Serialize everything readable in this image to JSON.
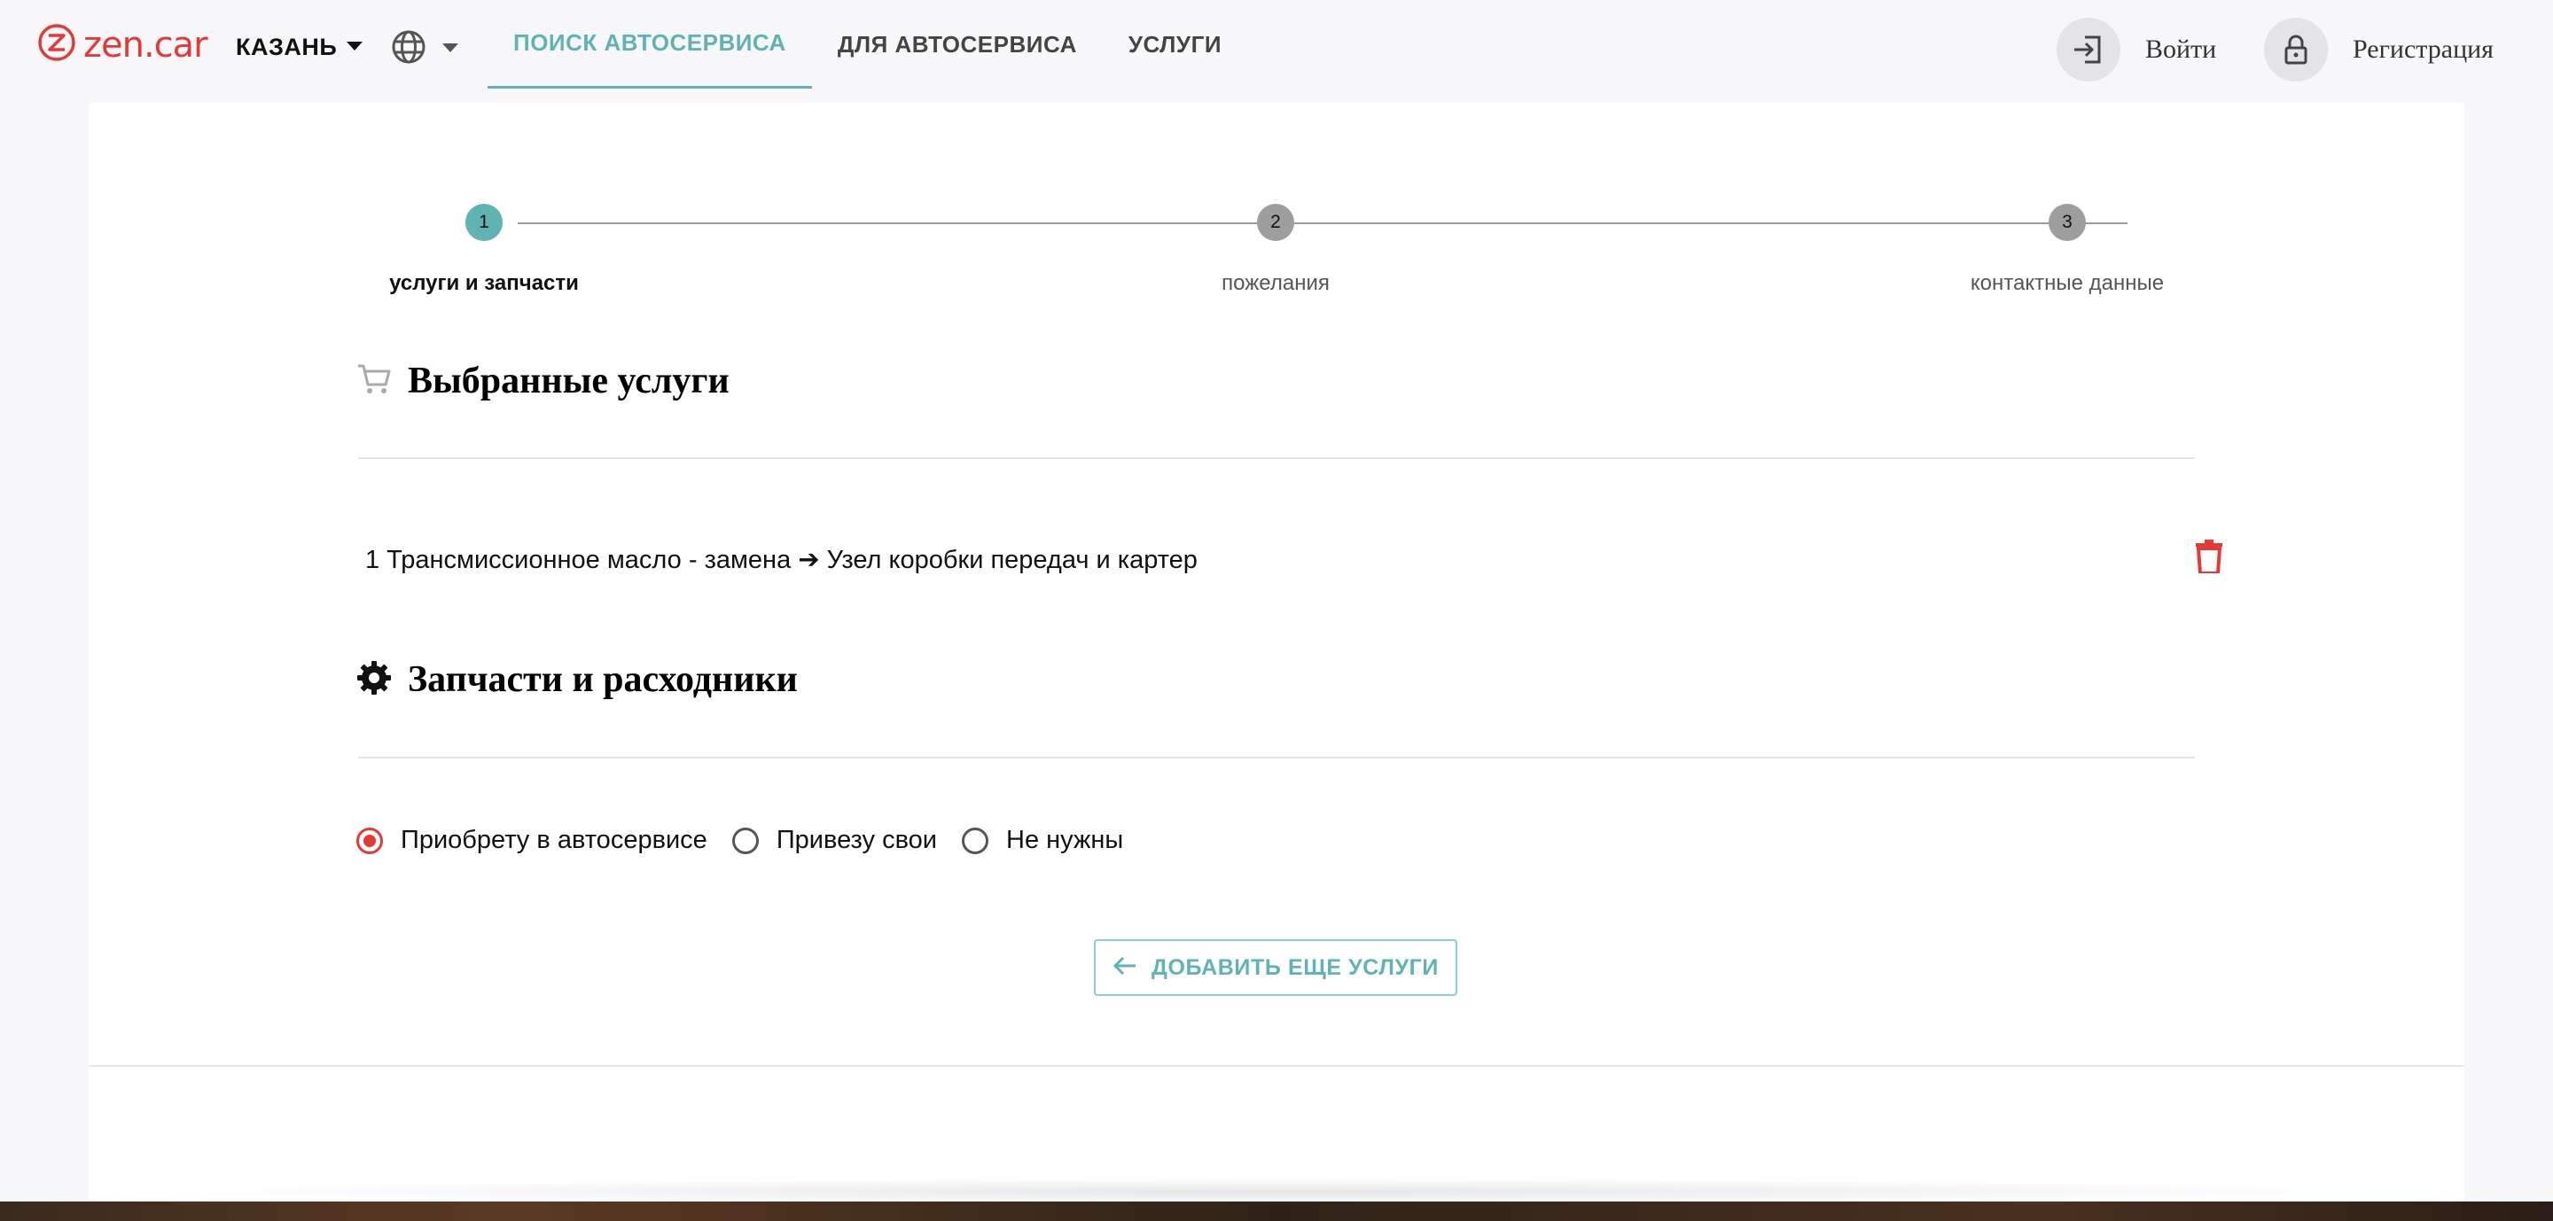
{
  "header": {
    "logo_text": "zen.car",
    "city": "КАЗАНЬ",
    "nav": [
      {
        "label": "ПОИСК АВТОСЕРВИСА",
        "active": true
      },
      {
        "label": "ДЛЯ АВТОСЕРВИСА",
        "active": false
      },
      {
        "label": "УСЛУГИ",
        "active": false
      }
    ],
    "login_label": "Войти",
    "register_label": "Регистрация"
  },
  "stepper": {
    "current": 1,
    "steps": [
      {
        "number": "1",
        "label": "услуги и запчасти"
      },
      {
        "number": "2",
        "label": "пожелания"
      },
      {
        "number": "3",
        "label": "контактные данные"
      }
    ]
  },
  "selected_services": {
    "title": "Выбранные услуги",
    "items": [
      {
        "text": "1 Трансмиссионное масло - замена ➔ Узел коробки передач и картер"
      }
    ]
  },
  "parts": {
    "title": "Запчасти и расходники",
    "options": [
      {
        "label": "Приобрету в автосервисе",
        "selected": true
      },
      {
        "label": "Привезу свои",
        "selected": false
      },
      {
        "label": "Не нужны",
        "selected": false
      }
    ]
  },
  "add_more_label": "ДОБАВИТЬ ЕЩЕ УСЛУГИ",
  "colors": {
    "accent": "#5fb3b3",
    "brand_red": "#e53935",
    "step_inactive": "#9e9e9e",
    "page_bg": "#f7f7f9"
  }
}
